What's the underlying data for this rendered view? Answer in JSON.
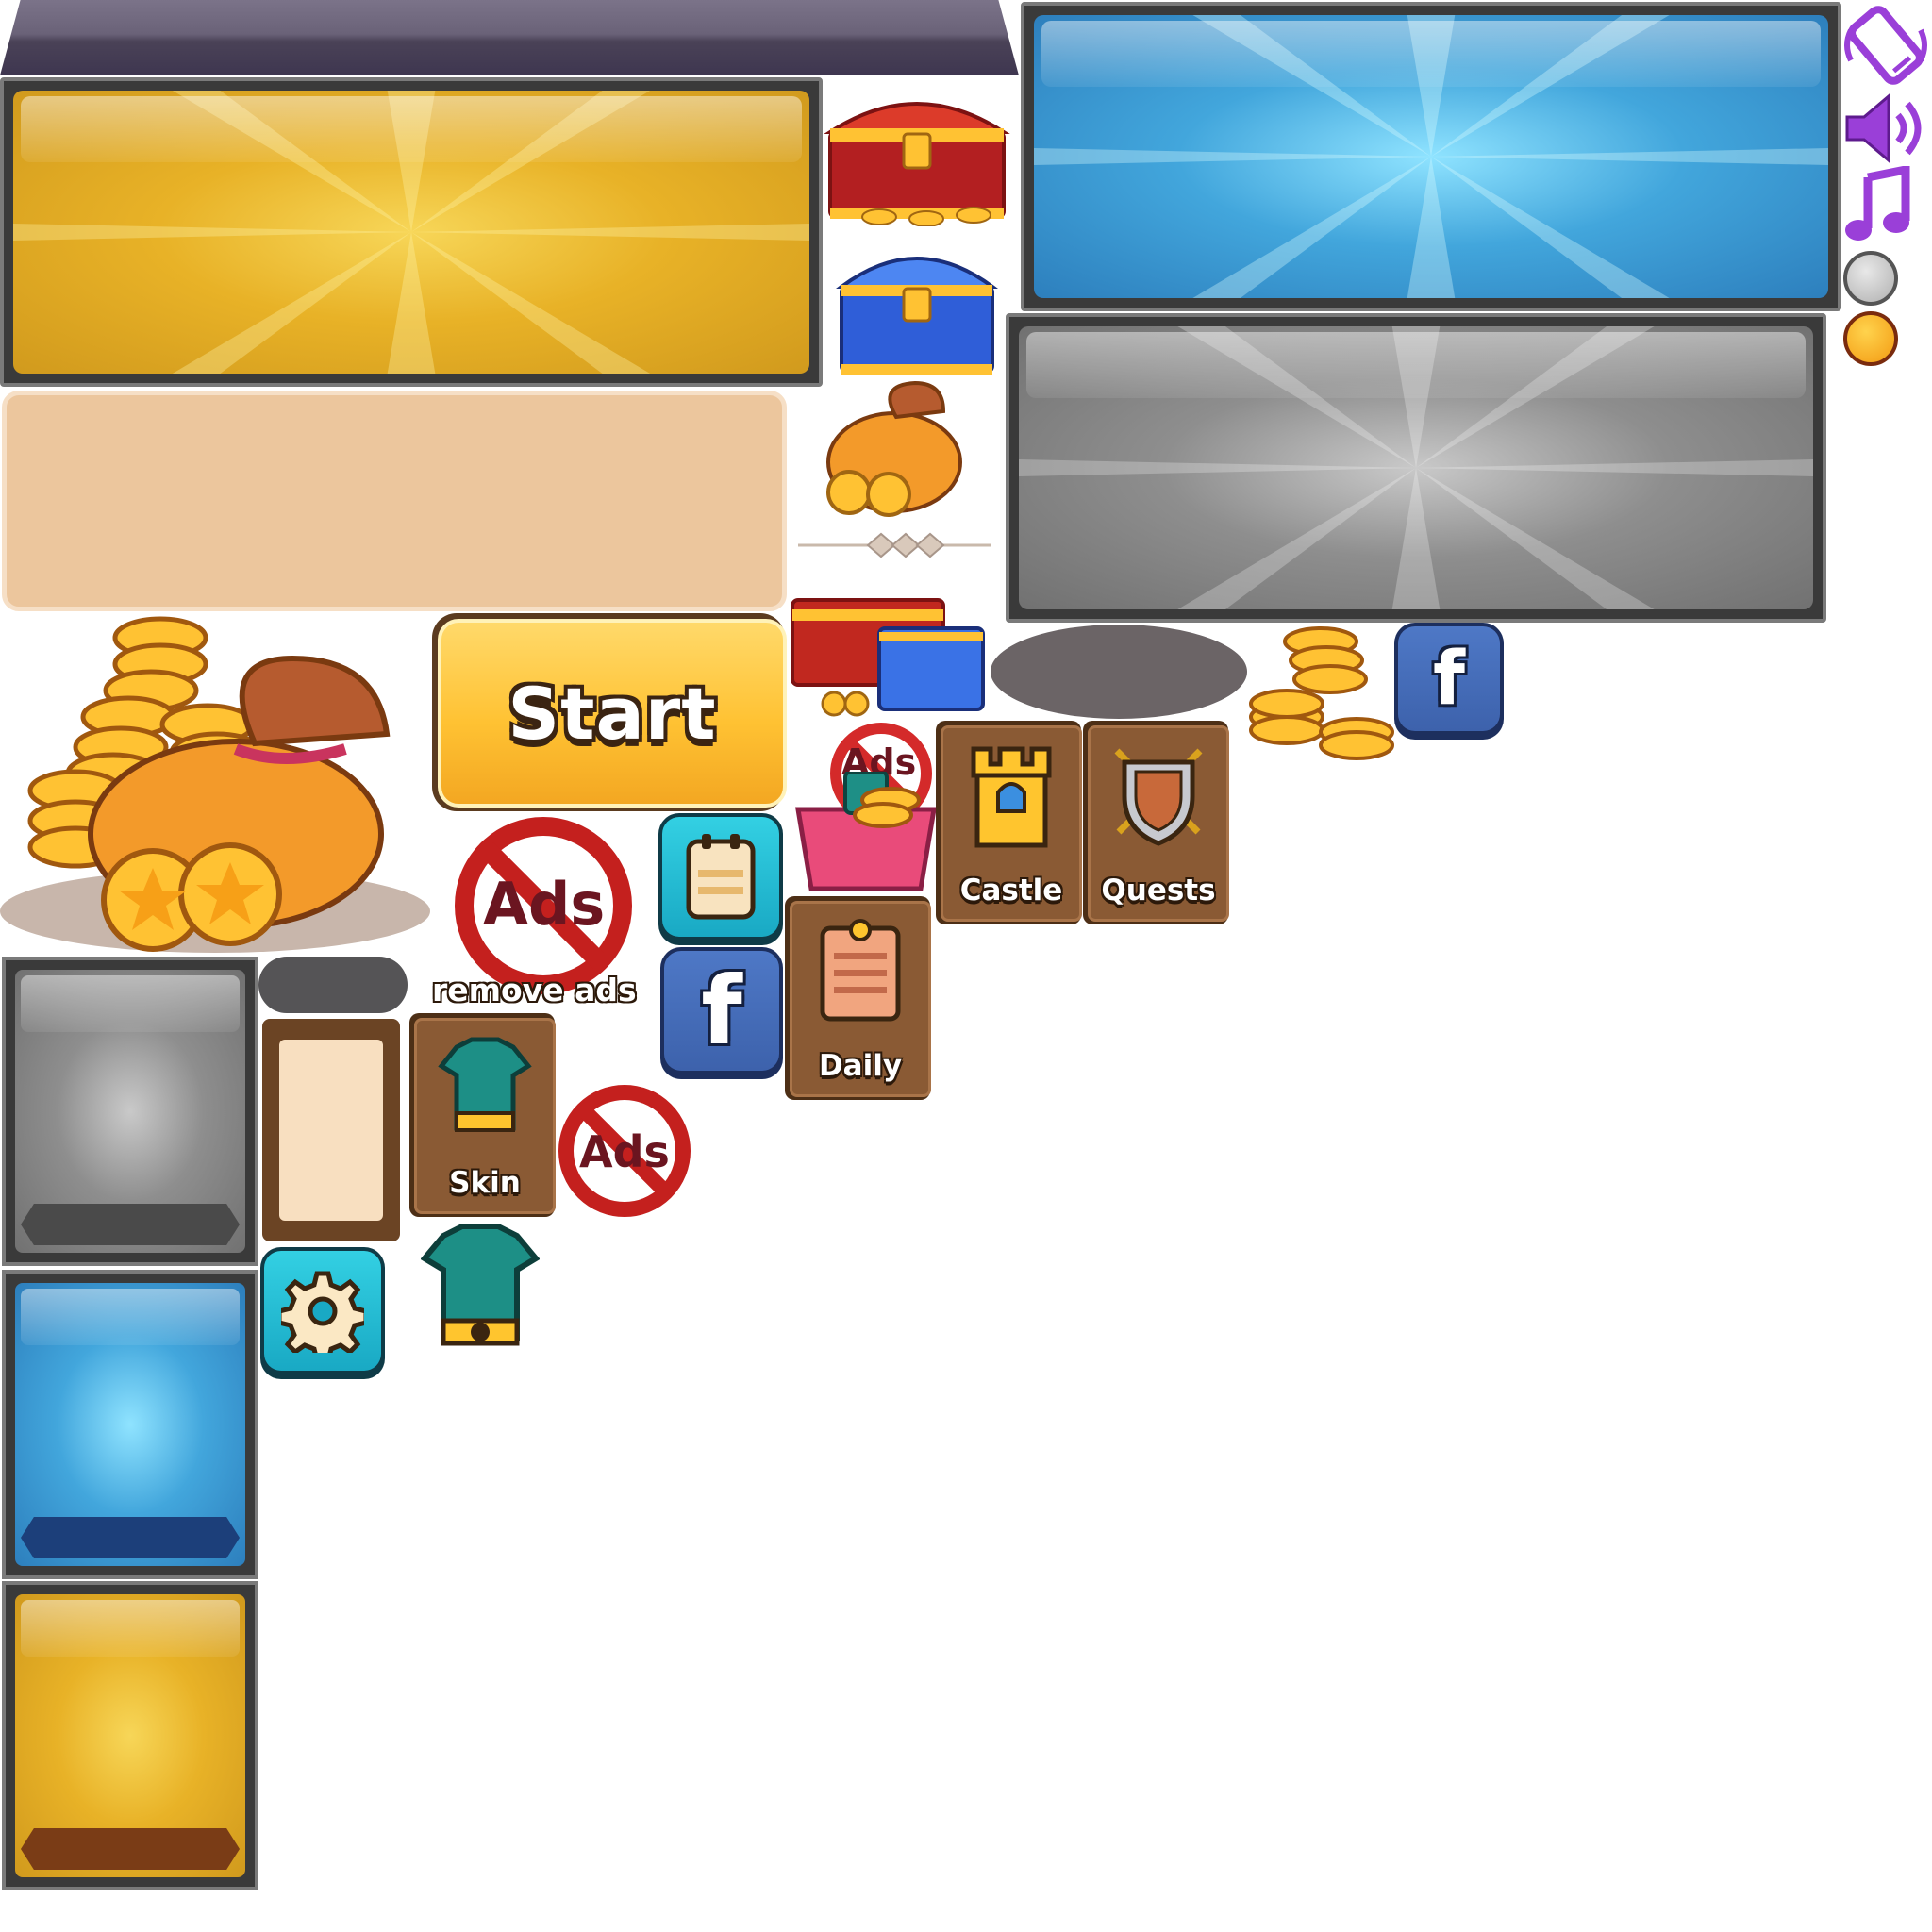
{
  "buttons": {
    "start_label": "Start",
    "castle_label": "Castle",
    "quests_label": "Quests",
    "daily_label": "Daily",
    "skin_label": "Skin",
    "remove_ads_label": "remove ads",
    "facebook_glyph": "f",
    "ads_sign_label": "Ads"
  },
  "icons": [
    "phone-vibrate-icon",
    "sound-icon",
    "music-note-icon",
    "grey-dot-icon",
    "gold-dot-icon",
    "red-treasure-chest-icon",
    "blue-treasure-chest-icon",
    "coin-bag-icon",
    "diamond-divider-icon",
    "chests-bundle-icon",
    "coin-stacks-icon",
    "facebook-icon",
    "no-ads-icon",
    "gift-box-icon",
    "castle-tower-icon",
    "shield-swords-icon",
    "notepad-icon",
    "daily-clipboard-icon",
    "armor-icon",
    "gear-icon"
  ],
  "colors": {
    "gold_panel": "#e8b227",
    "blue_panel": "#42a6dc",
    "grey_panel": "#8e8e8e",
    "beige_panel": "#ecc69d",
    "start_button": "#ffc233",
    "card_button": "#8a5a34",
    "facebook": "#3d62ac",
    "teal_button": "#19a9c4",
    "icon_purple": "#9a3fd8"
  }
}
